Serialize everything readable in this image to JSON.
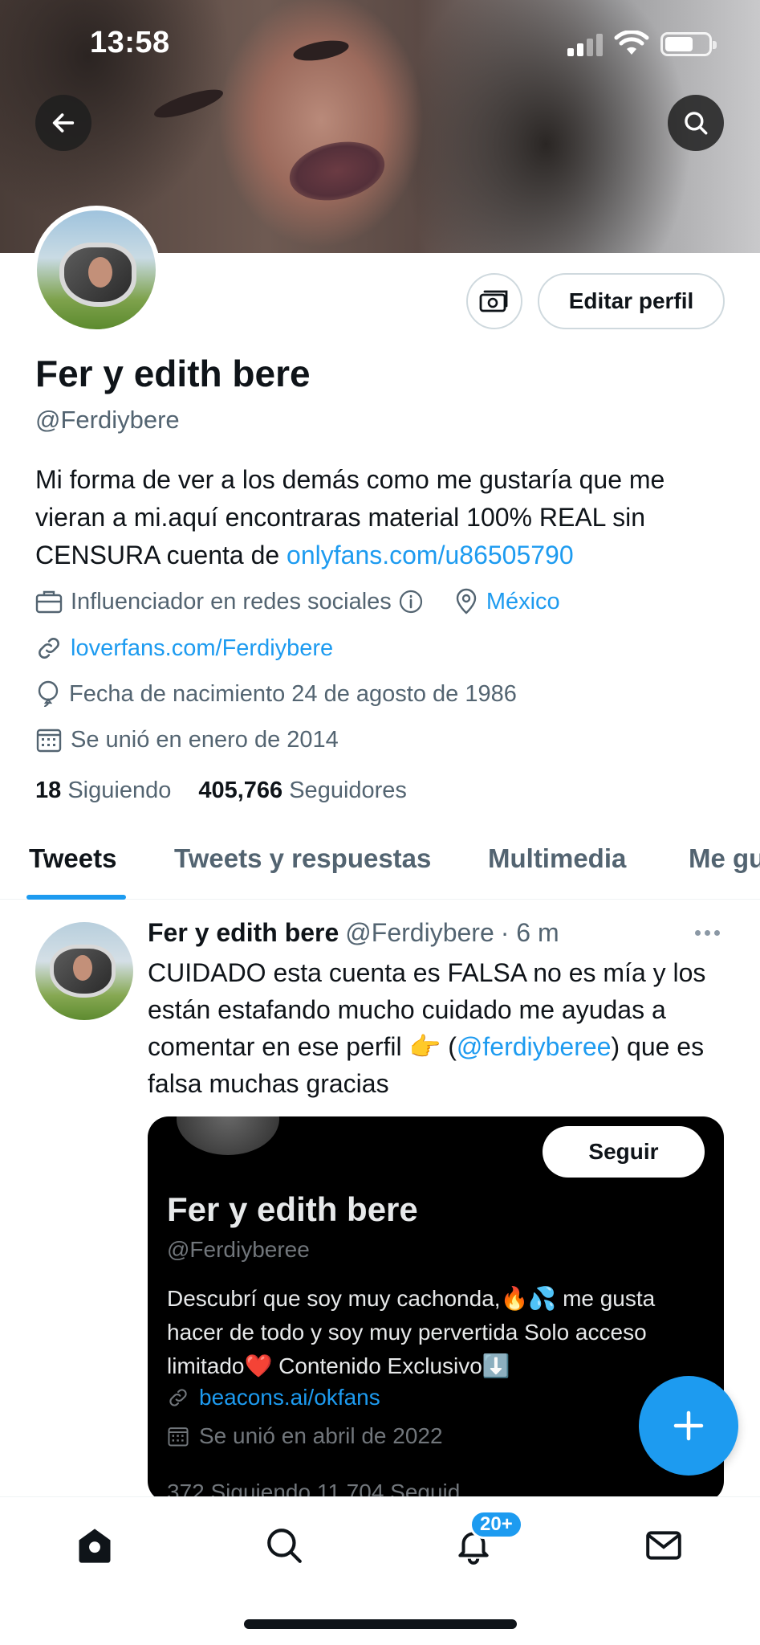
{
  "status_bar": {
    "time": "13:58"
  },
  "profile": {
    "display_name": "Fer y edith bere",
    "handle": "@Ferdiybere",
    "edit_button": "Editar perfil",
    "bio_text": "Mi forma de ver a los demás como me gustaría que me vieran a mi.aquí encontraras material 100% REAL sin CENSURA cuenta de ",
    "bio_link": "onlyfans.com/u86505790",
    "category": "Influenciador en redes sociales",
    "location": "México",
    "website": "loverfans.com/Ferdiybere",
    "birthday": "Fecha de nacimiento 24 de agosto de 1986",
    "joined": "Se unió en enero de 2014",
    "following_count": "18",
    "following_label": "Siguiendo",
    "followers_count": "405,766",
    "followers_label": "Seguidores"
  },
  "tabs": [
    {
      "label": "Tweets",
      "active": true
    },
    {
      "label": "Tweets y respuestas"
    },
    {
      "label": "Multimedia"
    },
    {
      "label": "Me gu"
    }
  ],
  "tweet": {
    "author": "Fer y edith bere",
    "handle": "@Ferdiybere",
    "time": "· 6 m",
    "text_before": "CUIDADO esta cuenta es FALSA no es mía y los están estafando mucho cuidado me ayudas a comentar en ese perfil 👉 (",
    "mention": "@ferdiyberee",
    "text_after": ") que es falsa muchas gracias",
    "image": {
      "follow_button": "Seguir",
      "name": "Fer y edith bere",
      "handle": "@Ferdiyberee",
      "bio": "Descubrí que soy muy cachonda,🔥💦 me gusta hacer de todo y soy muy pervertida Solo acceso limitado❤️ Contenido Exclusivo⬇️",
      "link": "beacons.ai/okfans",
      "joined": "Se unió en abril de 2022",
      "cut_off_line": "372 Siguiendo 11,704 Seguid"
    }
  },
  "bottom_nav": {
    "notifications_badge": "20+"
  },
  "colors": {
    "accent": "#1d9bf0",
    "text": "#0f1419",
    "muted": "#536471"
  },
  "icons": [
    "back-arrow-icon",
    "search-icon",
    "money-icon",
    "briefcase-icon",
    "info-icon",
    "location-pin-icon",
    "link-icon",
    "balloon-icon",
    "calendar-icon",
    "more-dots-icon",
    "plus-icon",
    "home-icon",
    "bell-icon",
    "mail-icon"
  ]
}
